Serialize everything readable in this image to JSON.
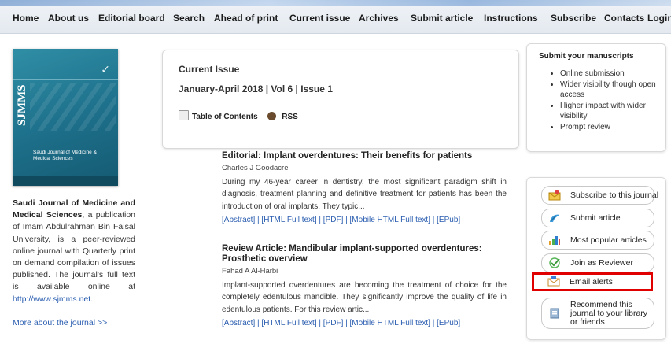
{
  "nav": {
    "items": [
      "Home",
      "About us",
      "Editorial board",
      "Search",
      "Ahead of print",
      "Current issue",
      "Archives",
      "Submit article",
      "Instructions",
      "Subscribe",
      "Contacts",
      "Login"
    ]
  },
  "cover": {
    "big_text": "SJMMS",
    "title": "Saudi Journal of Medicine & Medical Sciences"
  },
  "left": {
    "journal_name": "Saudi Journal of Medicine and Medical Sciences",
    "description": ", a publication of Imam Abdulrahman Bin Faisal University, is a peer-reviewed online journal with Quarterly print on demand compilation of issues published. The journal's full text is available online at ",
    "link": "http://www.sjmms.net.",
    "more": "More about the journal >>"
  },
  "issue": {
    "heading": "Current Issue",
    "sub": "January-April 2018 | Vol 6 | Issue 1",
    "toc": "Table of Contents",
    "rss": "RSS"
  },
  "articles": [
    {
      "title": "Editorial: Implant overdentures: Their benefits for patients",
      "author": "Charles J Goodacre",
      "snippet": "During my 46-year career in dentistry, the most significant paradigm shift in diagnosis, treatment planning and definitive treatment for patients has been the introduction of oral implants. They typic...",
      "links": [
        "[Abstract]",
        "[HTML Full text]",
        "[PDF]",
        "[Mobile HTML Full text]",
        "[EPub]"
      ]
    },
    {
      "title": "Review Article: Mandibular implant-supported overdentures: Prosthetic overview",
      "author": "Fahad A Al-Harbi",
      "snippet": "Implant-supported overdentures are becoming the treatment of choice for the completely edentulous mandible. They significantly improve the quality of life in edentulous patients. For this review artic...",
      "links": [
        "[Abstract]",
        "[HTML Full text]",
        "[PDF]",
        "[Mobile HTML Full text]",
        "[EPub]"
      ]
    }
  ],
  "manuscripts": {
    "title": "Submit your manuscripts",
    "items": [
      "Online submission",
      "Wider visibility though open access",
      "Higher impact with wider visibility",
      "Prompt review"
    ]
  },
  "tools": {
    "subscribe": "Subscribe to this journal",
    "submit": "Submit article",
    "popular": "Most popular articles",
    "reviewer": "Join as Reviewer",
    "email": "Email alerts",
    "recommend": "Recommend this journal to your library or friends"
  },
  "colors": {
    "link": "#2a5db0",
    "highlight": "#e00000",
    "cover": "#1d6f8a"
  }
}
